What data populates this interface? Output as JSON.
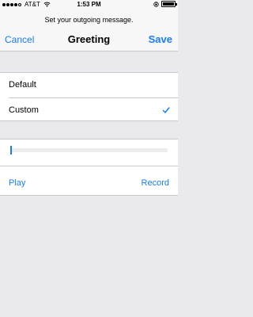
{
  "status_bar": {
    "carrier": "AT&T",
    "time": "1:53 PM",
    "signal_bars": 4,
    "battery_level_pct": 100
  },
  "nav": {
    "prompt": "Set your outgoing message.",
    "cancel_label": "Cancel",
    "title": "Greeting",
    "save_label": "Save"
  },
  "options": [
    {
      "label": "Default",
      "selected": false
    },
    {
      "label": "Custom",
      "selected": true
    }
  ],
  "player": {
    "progress_pct": 0,
    "play_label": "Play",
    "record_label": "Record"
  },
  "colors": {
    "accent": "#1a7cf5",
    "background": "#e9e9ee",
    "separator": "#c8c7cc"
  },
  "icons": [
    "wifi-icon",
    "lock-rotation-icon",
    "battery-icon",
    "checkmark-icon"
  ]
}
